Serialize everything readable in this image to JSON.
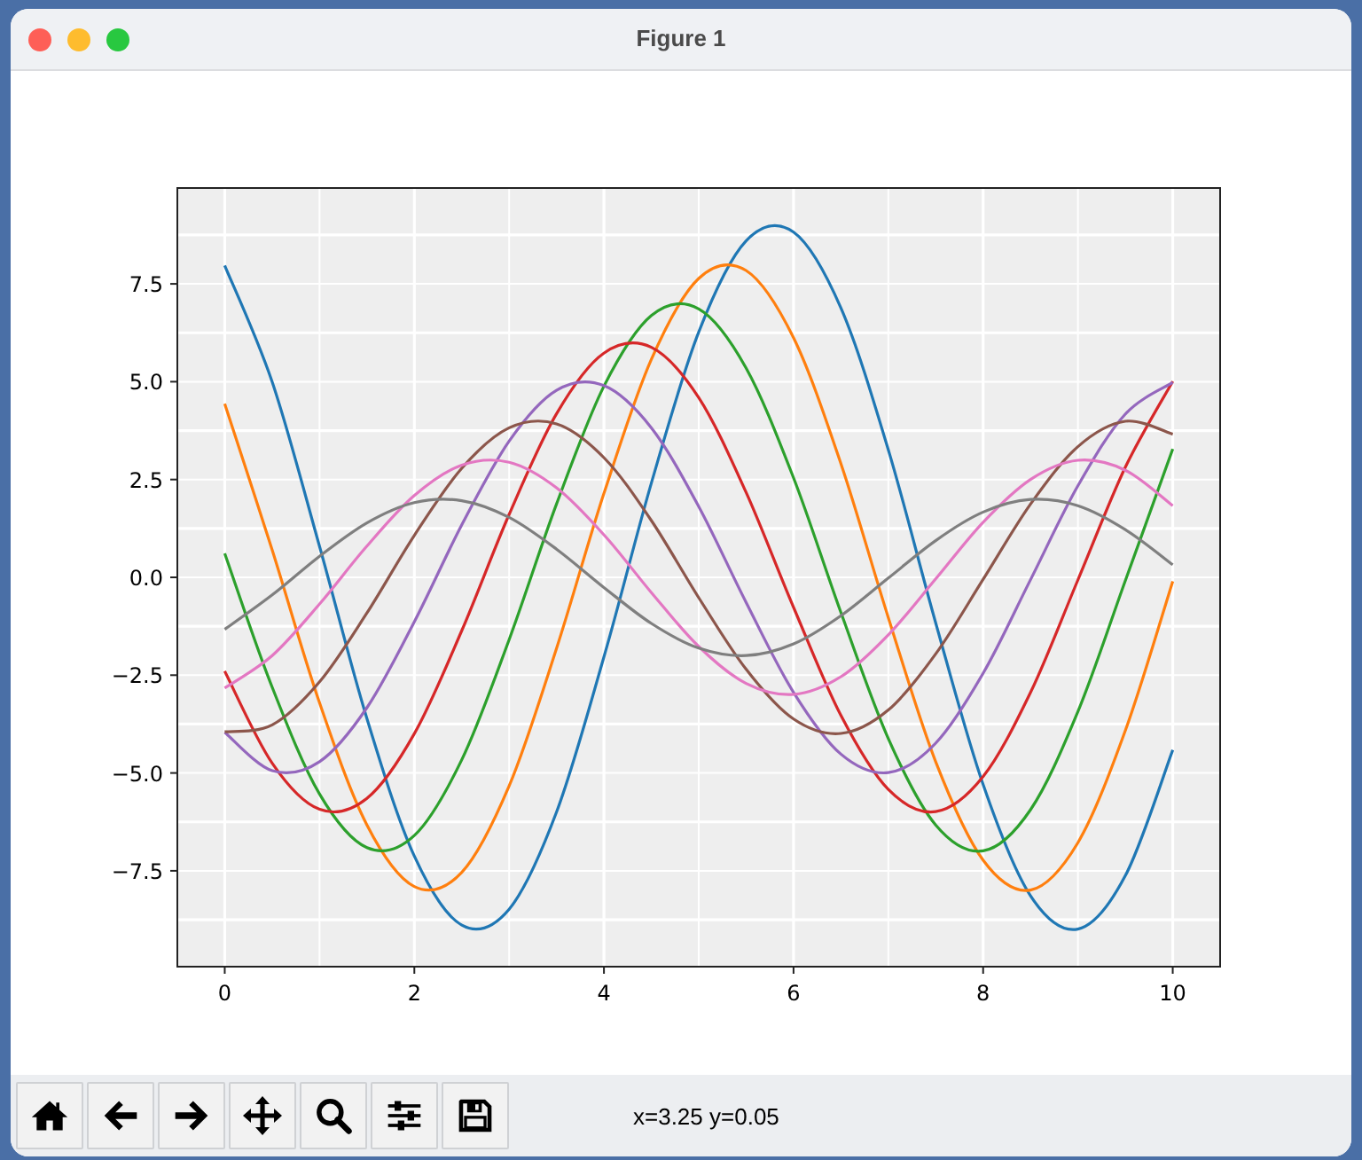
{
  "window": {
    "title": "Figure 1"
  },
  "figure": {
    "chart_data": {
      "type": "line",
      "x": [
        0,
        0.5,
        1,
        1.5,
        2,
        2.5,
        3,
        3.5,
        4,
        4.5,
        5,
        5.5,
        6,
        6.5,
        7,
        7.5,
        8,
        8.5,
        9,
        9.5,
        10
      ],
      "series": [
        {
          "color": "#1f77b4",
          "values": [
            7.97,
            4.99,
            0.79,
            -3.61,
            -7.12,
            -8.89,
            -8.48,
            -6.0,
            -2.04,
            2.41,
            6.27,
            8.6,
            8.82,
            6.88,
            3.26,
            -1.16,
            -5.3,
            -8.14,
            -8.99,
            -7.63,
            -4.41
          ]
        },
        {
          "color": "#ff7f0e",
          "values": [
            4.44,
            0.7,
            -3.21,
            -6.33,
            -7.9,
            -7.54,
            -5.33,
            -1.82,
            2.14,
            5.57,
            7.64,
            7.84,
            6.12,
            2.9,
            -1.03,
            -4.71,
            -7.23,
            -7.99,
            -6.78,
            -3.92,
            -0.1
          ]
        },
        {
          "color": "#2ca02c",
          "values": [
            0.61,
            -2.81,
            -5.54,
            -6.91,
            -6.6,
            -4.66,
            -1.59,
            1.87,
            4.88,
            6.69,
            6.86,
            5.35,
            2.54,
            -0.9,
            -4.12,
            -6.33,
            -6.99,
            -5.94,
            -3.43,
            -0.09,
            3.28
          ]
        },
        {
          "color": "#d62728",
          "values": [
            -2.4,
            -4.75,
            -5.93,
            -5.65,
            -4.0,
            -1.36,
            1.61,
            4.18,
            5.73,
            5.88,
            4.59,
            2.17,
            -0.77,
            -3.53,
            -5.42,
            -5.99,
            -5.09,
            -2.94,
            -0.07,
            2.81,
            5.01
          ]
        },
        {
          "color": "#9467bd",
          "values": [
            -3.96,
            -4.94,
            -4.71,
            -3.33,
            -1.14,
            1.34,
            3.48,
            4.78,
            4.9,
            3.82,
            1.81,
            -0.64,
            -2.94,
            -4.52,
            -4.99,
            -4.24,
            -2.45,
            -0.06,
            2.34,
            4.17,
            4.98
          ]
        },
        {
          "color": "#8c564b",
          "values": [
            -3.95,
            -3.77,
            -2.67,
            -0.91,
            1.07,
            2.79,
            3.82,
            3.92,
            3.06,
            1.45,
            -0.52,
            -2.35,
            -3.62,
            -3.99,
            -3.39,
            -1.96,
            -0.05,
            1.87,
            3.34,
            3.99,
            3.66
          ]
        },
        {
          "color": "#e377c2",
          "values": [
            -2.83,
            -2.0,
            -0.68,
            0.8,
            2.09,
            2.87,
            2.94,
            2.29,
            1.09,
            -0.39,
            -1.77,
            -2.71,
            -2.99,
            -2.54,
            -1.47,
            -0.04,
            1.41,
            2.5,
            2.99,
            2.74,
            1.83
          ]
        },
        {
          "color": "#7f7f7f",
          "values": [
            -1.33,
            -0.45,
            0.54,
            1.39,
            1.91,
            1.96,
            1.53,
            0.72,
            -0.26,
            -1.18,
            -1.81,
            -2.0,
            -1.7,
            -0.98,
            -0.02,
            0.94,
            1.67,
            1.99,
            1.83,
            1.22,
            0.32
          ]
        }
      ],
      "grid": true,
      "xlim": [
        -0.5,
        10.5
      ],
      "ylim": [
        -9.95,
        9.95
      ],
      "xticks": [
        0,
        2,
        4,
        6,
        8,
        10
      ],
      "yticks": [
        {
          "value": -7.5,
          "label": "−7.5"
        },
        {
          "value": -5,
          "label": "−5.0"
        },
        {
          "value": -2.5,
          "label": "−2.5"
        },
        {
          "value": 0,
          "label": "0.0"
        },
        {
          "value": 2.5,
          "label": "2.5"
        },
        {
          "value": 5,
          "label": "5.0"
        },
        {
          "value": 7.5,
          "label": "7.5"
        }
      ]
    }
  },
  "toolbar": {
    "buttons": [
      {
        "kind": "home"
      },
      {
        "kind": "back"
      },
      {
        "kind": "forward"
      },
      {
        "kind": "pan"
      },
      {
        "kind": "zoom"
      },
      {
        "kind": "configure"
      },
      {
        "kind": "save"
      }
    ],
    "status": "x=3.25 y=0.05"
  }
}
